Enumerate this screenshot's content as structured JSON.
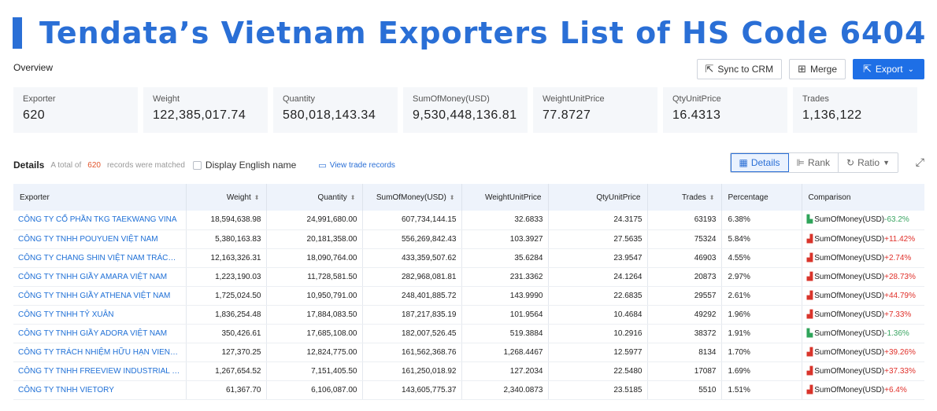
{
  "headline": "Tendata’s Vietnam Exporters List of HS Code 6404",
  "overview": {
    "label": "Overview",
    "buttons": {
      "sync": "Sync to CRM",
      "merge": "Merge",
      "export": "Export"
    }
  },
  "stats": [
    {
      "label": "Exporter",
      "value": "620"
    },
    {
      "label": "Weight",
      "value": "122,385,017.74"
    },
    {
      "label": "Quantity",
      "value": "580,018,143.34"
    },
    {
      "label": "SumOfMoney(USD)",
      "value": "9,530,448,136.81"
    },
    {
      "label": "WeightUnitPrice",
      "value": "77.8727"
    },
    {
      "label": "QtyUnitPrice",
      "value": "16.4313"
    },
    {
      "label": "Trades",
      "value": "1,136,122"
    }
  ],
  "details": {
    "title": "Details",
    "total_prefix": "A total of",
    "count": "620",
    "matched_suffix": "records were matched",
    "english_toggle": "Display English name",
    "view_records": "View trade records",
    "views": {
      "details": "Details",
      "rank": "Rank",
      "ratio": "Ratio"
    }
  },
  "table": {
    "columns": [
      "Exporter",
      "Weight",
      "Quantity",
      "SumOfMoney(USD)",
      "WeightUnitPrice",
      "QtyUnitPrice",
      "Trades",
      "Percentage",
      "Comparison"
    ],
    "rows": [
      {
        "exporter": "CÔNG TY CỔ PHẦN TKG TAEKWANG VINA",
        "weight": "18,594,638.98",
        "quantity": "24,991,680.00",
        "money": "607,734,144.15",
        "wup": "32.6833",
        "qup": "24.3175",
        "trades": "63193",
        "pct": "6.38%",
        "metric": "SumOfMoney(USD)",
        "change": "-63.2%",
        "trend": "down"
      },
      {
        "exporter": "CÔNG TY TNHH POUYUEN VIỆT NAM",
        "weight": "5,380,163.83",
        "quantity": "20,181,358.00",
        "money": "556,269,842.43",
        "wup": "103.3927",
        "qup": "27.5635",
        "trades": "75324",
        "pct": "5.84%",
        "metric": "SumOfMoney(USD)",
        "change": "+11.42%",
        "trend": "up"
      },
      {
        "exporter": "CÔNG TY CHANG SHIN VIỆT NAM TRÁCH N...",
        "weight": "12,163,326.31",
        "quantity": "18,090,764.00",
        "money": "433,359,507.62",
        "wup": "35.6284",
        "qup": "23.9547",
        "trades": "46903",
        "pct": "4.55%",
        "metric": "SumOfMoney(USD)",
        "change": "+2.74%",
        "trend": "up"
      },
      {
        "exporter": "CÔNG TY TNHH GIẦY AMARA VIỆT NAM",
        "weight": "1,223,190.03",
        "quantity": "11,728,581.50",
        "money": "282,968,081.81",
        "wup": "231.3362",
        "qup": "24.1264",
        "trades": "20873",
        "pct": "2.97%",
        "metric": "SumOfMoney(USD)",
        "change": "+28.73%",
        "trend": "up"
      },
      {
        "exporter": "CÔNG TY TNHH GIẦY ATHENA VIỆT NAM",
        "weight": "1,725,024.50",
        "quantity": "10,950,791.00",
        "money": "248,401,885.72",
        "wup": "143.9990",
        "qup": "22.6835",
        "trades": "29557",
        "pct": "2.61%",
        "metric": "SumOfMoney(USD)",
        "change": "+44.79%",
        "trend": "up"
      },
      {
        "exporter": "CÔNG TY TNHH TỶ XUÂN",
        "weight": "1,836,254.48",
        "quantity": "17,884,083.50",
        "money": "187,217,835.19",
        "wup": "101.9564",
        "qup": "10.4684",
        "trades": "49292",
        "pct": "1.96%",
        "metric": "SumOfMoney(USD)",
        "change": "+7.33%",
        "trend": "up"
      },
      {
        "exporter": "CÔNG TY TNHH GIẦY ADORA VIỆT NAM",
        "weight": "350,426.61",
        "quantity": "17,685,108.00",
        "money": "182,007,526.45",
        "wup": "519.3884",
        "qup": "10.2916",
        "trades": "38372",
        "pct": "1.91%",
        "metric": "SumOfMoney(USD)",
        "change": "-1.36%",
        "trend": "down"
      },
      {
        "exporter": "CÔNG TY TRÁCH NHIỆM HỮU HẠN VIENERGY",
        "weight": "127,370.25",
        "quantity": "12,824,775.00",
        "money": "161,562,368.76",
        "wup": "1,268.4467",
        "qup": "12.5977",
        "trades": "8134",
        "pct": "1.70%",
        "metric": "SumOfMoney(USD)",
        "change": "+39.26%",
        "trend": "up"
      },
      {
        "exporter": "CÔNG TY TNHH FREEVIEW INDUSTRIAL VIỆ...",
        "weight": "1,267,654.52",
        "quantity": "7,151,405.50",
        "money": "161,250,018.92",
        "wup": "127.2034",
        "qup": "22.5480",
        "trades": "17087",
        "pct": "1.69%",
        "metric": "SumOfMoney(USD)",
        "change": "+37.33%",
        "trend": "up"
      },
      {
        "exporter": "CÔNG TY TNHH VIETORY",
        "weight": "61,367.70",
        "quantity": "6,106,087.00",
        "money": "143,605,775.37",
        "wup": "2,340.0873",
        "qup": "23.5185",
        "trades": "5510",
        "pct": "1.51%",
        "metric": "SumOfMoney(USD)",
        "change": "+6.4%",
        "trend": "up"
      }
    ]
  }
}
